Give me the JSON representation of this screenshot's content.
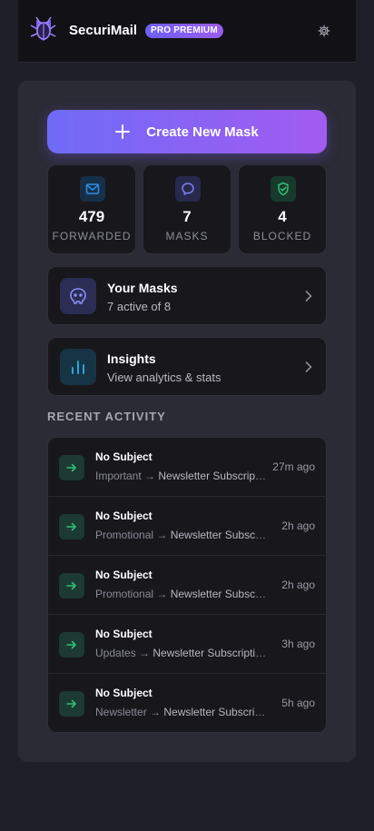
{
  "header": {
    "app_name": "SecuriMail",
    "badge": "PRO PREMIUM",
    "logo_icon": "shield-bug-logo-icon",
    "settings_icon": "gear-icon"
  },
  "colors": {
    "accent_start": "#6f6bf7",
    "accent_end": "#a25bf0",
    "forwarded": "#2f8fe6",
    "masks": "#7b7ff0",
    "blocked": "#2fbf7a",
    "insights": "#28a7d8",
    "activity_arrow": "#2fbf7a"
  },
  "create_button": {
    "label": "Create New Mask",
    "icon": "plus-icon"
  },
  "stats": [
    {
      "value": "479",
      "label": "FORWARDED",
      "icon": "mail-icon"
    },
    {
      "value": "7",
      "label": "MASKS",
      "icon": "chat-bubble-icon"
    },
    {
      "value": "4",
      "label": "BLOCKED",
      "icon": "shield-check-icon"
    }
  ],
  "masks_card": {
    "title": "Your Masks",
    "subtitle": "7 active of 8",
    "icon": "mask-face-icon"
  },
  "insights_card": {
    "title": "Insights",
    "subtitle": "View analytics & stats",
    "icon": "bar-chart-icon"
  },
  "recent_activity": {
    "title": "RECENT ACTIVITY",
    "items": [
      {
        "subject": "No Subject",
        "category": "Important",
        "destination": "Newsletter Subscriptions",
        "time": "27m ago"
      },
      {
        "subject": "No Subject",
        "category": "Promotional",
        "destination": "Newsletter Subscriptions",
        "time": "2h ago"
      },
      {
        "subject": "No Subject",
        "category": "Promotional",
        "destination": "Newsletter Subscriptions",
        "time": "2h ago"
      },
      {
        "subject": "No Subject",
        "category": "Updates",
        "destination": "Newsletter Subscriptions",
        "time": "3h ago"
      },
      {
        "subject": "No Subject",
        "category": "Newsletter",
        "destination": "Newsletter Subscriptions",
        "time": "5h ago"
      }
    ]
  }
}
